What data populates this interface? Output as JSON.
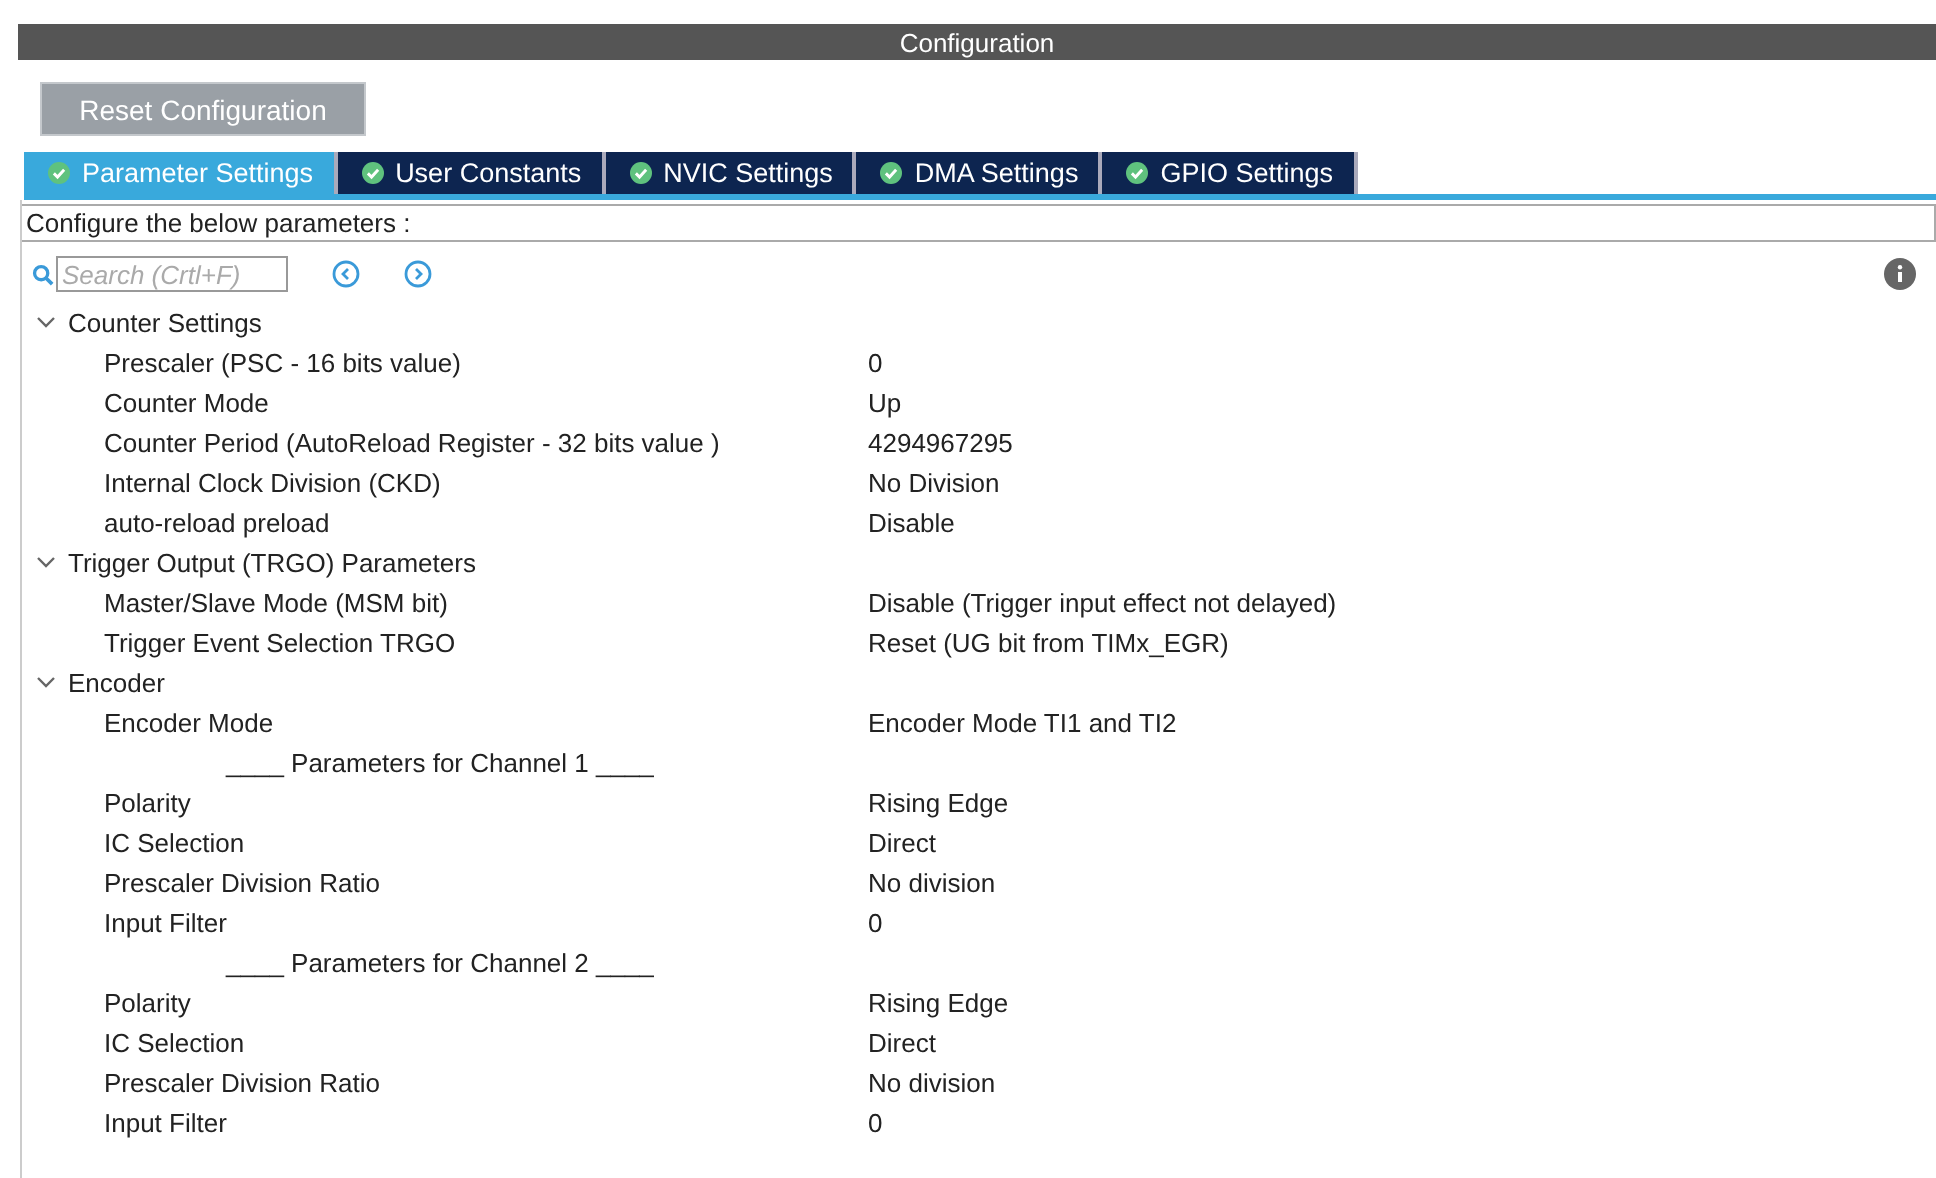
{
  "window": {
    "title": "Configuration"
  },
  "reset_button": "Reset Configuration",
  "tabs": [
    {
      "label": "Parameter Settings",
      "selected": true
    },
    {
      "label": "User Constants",
      "selected": false
    },
    {
      "label": "NVIC Settings",
      "selected": false
    },
    {
      "label": "DMA Settings",
      "selected": false
    },
    {
      "label": "GPIO Settings",
      "selected": false
    }
  ],
  "hint": "Configure the below parameters :",
  "search": {
    "placeholder": "Search (Crtl+F)"
  },
  "sections": [
    {
      "label": "Counter Settings",
      "expanded": true,
      "children": [
        {
          "kind": "param",
          "label": "Prescaler (PSC - 16 bits value)",
          "value": "0"
        },
        {
          "kind": "param",
          "label": "Counter Mode",
          "value": "Up"
        },
        {
          "kind": "param",
          "label": "Counter Period (AutoReload Register - 32 bits value )",
          "value": "4294967295"
        },
        {
          "kind": "param",
          "label": "Internal Clock Division (CKD)",
          "value": "No Division"
        },
        {
          "kind": "param",
          "label": "auto-reload preload",
          "value": "Disable"
        }
      ]
    },
    {
      "label": "Trigger Output (TRGO) Parameters",
      "expanded": true,
      "children": [
        {
          "kind": "param",
          "label": "Master/Slave Mode (MSM bit)",
          "value": "Disable (Trigger input effect not delayed)"
        },
        {
          "kind": "param",
          "label": "Trigger Event Selection TRGO",
          "value": "Reset (UG bit from TIMx_EGR)"
        }
      ]
    },
    {
      "label": "Encoder",
      "expanded": true,
      "children": [
        {
          "kind": "param",
          "label": "Encoder Mode",
          "value": "Encoder Mode TI1 and TI2"
        },
        {
          "kind": "separator",
          "label": "____ Parameters for Channel 1 ____"
        },
        {
          "kind": "param",
          "label": "Polarity",
          "value": "Rising Edge"
        },
        {
          "kind": "param",
          "label": "IC Selection",
          "value": "Direct"
        },
        {
          "kind": "param",
          "label": "Prescaler Division Ratio",
          "value": "No division"
        },
        {
          "kind": "param",
          "label": "Input Filter",
          "value": "0"
        },
        {
          "kind": "separator",
          "label": "____ Parameters for Channel 2 ____"
        },
        {
          "kind": "param",
          "label": "Polarity",
          "value": "Rising Edge"
        },
        {
          "kind": "param",
          "label": "IC Selection",
          "value": "Direct"
        },
        {
          "kind": "param",
          "label": "Prescaler Division Ratio",
          "value": "No division"
        },
        {
          "kind": "param",
          "label": "Input Filter",
          "value": "0"
        }
      ]
    }
  ]
}
